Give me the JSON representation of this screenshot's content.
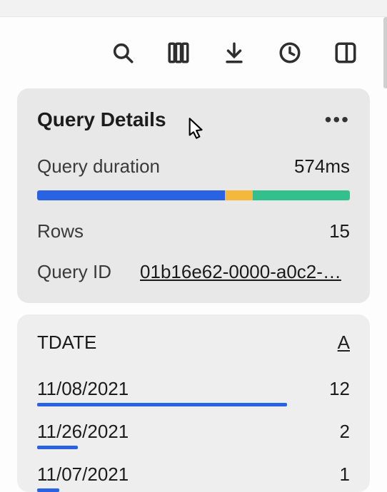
{
  "toolbar": {
    "icons": {
      "search": "search-icon",
      "columns": "columns-icon",
      "download": "download-icon",
      "history": "history-icon",
      "panel": "panel-icon"
    }
  },
  "details": {
    "title": "Query Details",
    "duration_label": "Query duration",
    "duration_value": "574ms",
    "segments": [
      {
        "pct": 60,
        "color": "#2a62e4"
      },
      {
        "pct": 9,
        "color": "#f3b83c"
      },
      {
        "pct": 31,
        "color": "#34bf8e"
      }
    ],
    "rows_label": "Rows",
    "rows_value": "15",
    "qid_label": "Query ID",
    "qid_value": "01b16e62-0000-a0c2-…"
  },
  "results": {
    "column_name": "TDATE",
    "column_type": "A",
    "rows": [
      {
        "date": "11/08/2021",
        "count": "12",
        "bar_pct": 80
      },
      {
        "date": "11/26/2021",
        "count": "2",
        "bar_pct": 13
      },
      {
        "date": "11/07/2021",
        "count": "1",
        "bar_pct": 7
      }
    ]
  }
}
